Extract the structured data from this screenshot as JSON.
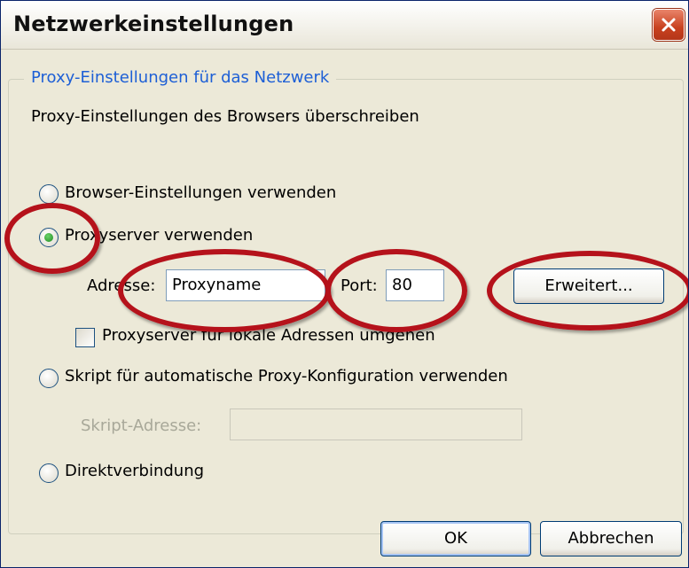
{
  "window": {
    "title": "Netzwerkeinstellungen",
    "close_icon": "close-icon"
  },
  "group": {
    "legend": "Proxy-Einstellungen für das Netzwerk",
    "description": "Proxy-Einstellungen des Browsers überschreiben"
  },
  "options": {
    "browser_settings": "Browser-Einstellungen verwenden",
    "proxy_server": "Proxyserver verwenden",
    "auto_script": "Skript für automatische Proxy-Konfiguration verwenden",
    "direct": "Direktverbindung",
    "selected": "proxy_server"
  },
  "proxy": {
    "address_label": "Adresse:",
    "address_value": "Proxyname",
    "port_label": "Port:",
    "port_value": "80",
    "advanced_button": "Erweitert...",
    "bypass_local_label": "Proxyserver für lokale Adressen umgehen",
    "bypass_local_checked": false
  },
  "script": {
    "address_label": "Skript-Adresse:",
    "address_value": ""
  },
  "buttons": {
    "ok": "OK",
    "cancel": "Abbrechen"
  },
  "colors": {
    "annotation": "#b5121b",
    "legend_text": "#1d5fd6",
    "dialog_bg": "#ece9d8"
  }
}
